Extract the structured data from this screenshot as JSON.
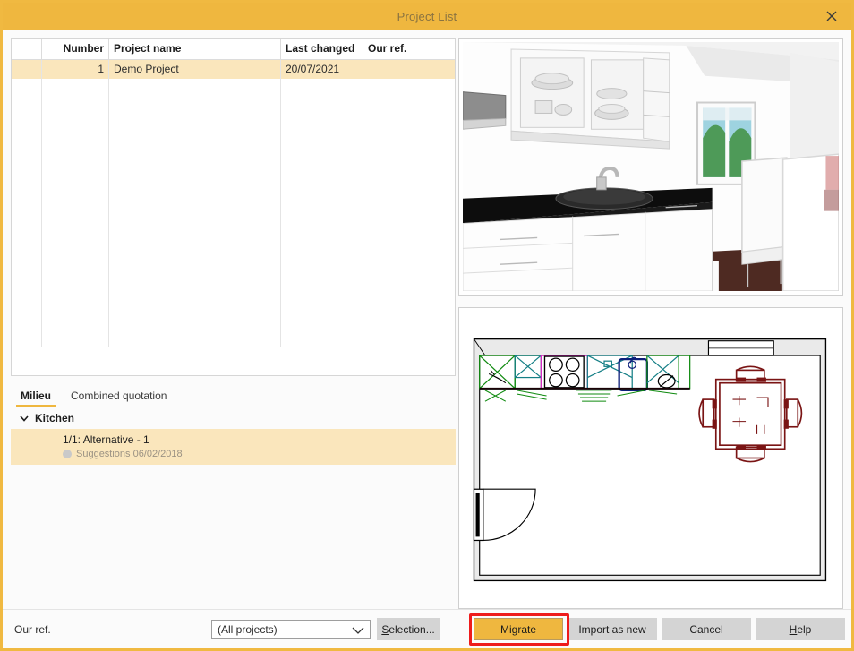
{
  "window": {
    "title": "Project List",
    "close_icon": "close-icon",
    "accent_color": "#efb73f",
    "selection_color": "#fae6bc",
    "highlight_color": "#ee1c1c"
  },
  "project_table": {
    "columns": [
      "",
      "Number",
      "Project name",
      "Last changed",
      "Our ref."
    ],
    "rows": [
      {
        "handle": "",
        "number": "1",
        "name": "Demo Project",
        "last_changed": "20/07/2021",
        "our_ref": "",
        "selected": true
      }
    ]
  },
  "tabs": [
    {
      "label": "Milieu",
      "active": true
    },
    {
      "label": "Combined quotation",
      "active": false
    }
  ],
  "tree": {
    "group": {
      "label": "Kitchen",
      "icon": "chevron-down-icon",
      "expanded": true
    },
    "items": [
      {
        "title": "1/1: Alternative - 1",
        "subtitle": "Suggestions 06/02/2018",
        "status_icon": "status-dot-icon",
        "selected": true
      }
    ]
  },
  "previews": {
    "render": {
      "name": "3d-kitchen-render",
      "description": "3D perspective render of kitchen with white cabinets, black granite worktop, sink, window and dining chairs"
    },
    "plan": {
      "name": "floor-plan-drawing",
      "description": "2D CAD floor plan with cabinet run, dining table with four chairs, door and window"
    }
  },
  "footer": {
    "our_ref_label": "Our ref.",
    "filter_select": {
      "value": "(All projects)",
      "placeholder": "(All projects)",
      "chevron_icon": "chevron-down-icon"
    },
    "selection_button": {
      "prefix": "",
      "accel": "S",
      "rest": "election..."
    },
    "buttons": [
      {
        "label": "Migrate",
        "primary": true,
        "highlighted": true
      },
      {
        "label": "Import as new",
        "primary": false,
        "highlighted": false
      },
      {
        "label": "Cancel",
        "primary": false,
        "highlighted": false
      }
    ],
    "help_button": {
      "accel": "H",
      "rest": "elp"
    }
  }
}
